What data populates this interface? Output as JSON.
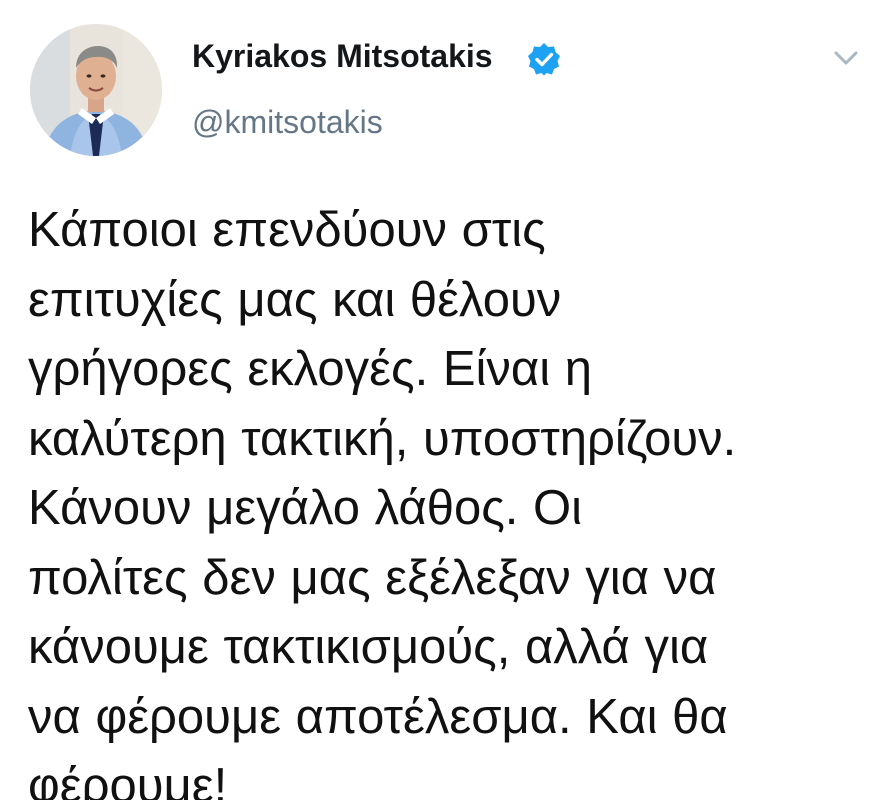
{
  "author": {
    "name": "Kyriakos Mitsotakis",
    "handle": "@kmitsotakis",
    "verified": true,
    "verified_color": "#1da1f2"
  },
  "icons": {
    "verified": "verified-badge-icon",
    "menu": "chevron-down-icon"
  },
  "tweet": {
    "lines": [
      "Κάποιοι επενδύουν στις",
      "επιτυχίες μας και θέλουν",
      "γρήγορες εκλογές. Είναι η",
      "καλύτερη τακτική, υποστηρίζουν.",
      "Κάνουν μεγάλο λάθος. Οι",
      "πολίτες δεν μας εξέλεξαν για να",
      "κάνουμε τακτικισμούς, αλλά για",
      "να φέρουμε αποτέλεσμα. Και θα",
      "φέρουμε!"
    ]
  }
}
